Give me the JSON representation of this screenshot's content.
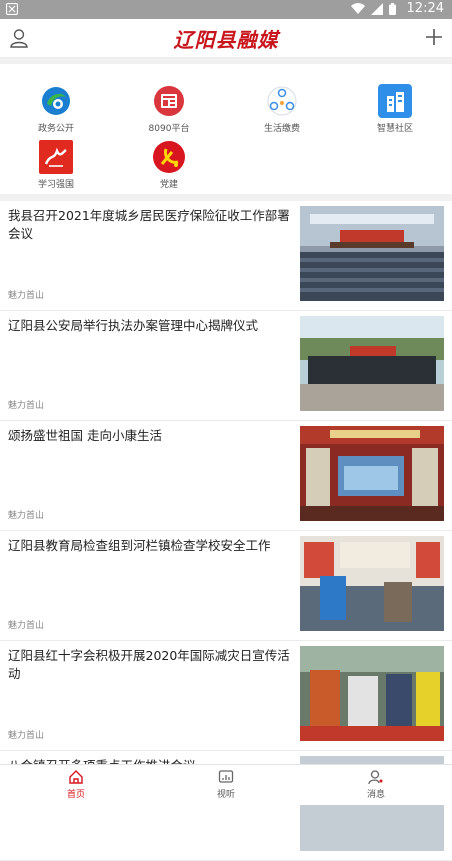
{
  "status_bar": {
    "time": "12:24",
    "icons": [
      "app-indicator-icon",
      "wifi-icon",
      "signal-icon",
      "battery-icon"
    ]
  },
  "header": {
    "logo_text": "辽阳县融媒",
    "icons": [
      "user-icon",
      "plus-icon"
    ]
  },
  "services": [
    {
      "label": "政务公开",
      "icon": "government-icon"
    },
    {
      "label": "8090平台",
      "icon": "platform-8090-icon"
    },
    {
      "label": "生活缴费",
      "icon": "life-payment-icon"
    },
    {
      "label": "智慧社区",
      "icon": "smart-community-icon"
    },
    {
      "label": "学习强国",
      "icon": "study-strong-country-icon"
    },
    {
      "label": "党建",
      "icon": "party-building-icon"
    }
  ],
  "news": [
    {
      "title": "我县召开2021年度城乡居民医疗保险征收工作部署会议",
      "source": "魅力首山"
    },
    {
      "title": "辽阳县公安局举行执法办案管理中心揭牌仪式",
      "source": "魅力首山"
    },
    {
      "title": "颂扬盛世祖国  走向小康生活",
      "source": "魅力首山"
    },
    {
      "title": "辽阳县教育局检查组到河栏镇检查学校安全工作",
      "source": "魅力首山"
    },
    {
      "title": "辽阳县红十字会积极开展2020年国际减灾日宣传活动",
      "source": "魅力首山"
    },
    {
      "title": "八会镇召开多项重点工作推进会议",
      "source": ""
    }
  ],
  "bottom_nav": [
    {
      "label": "首页",
      "icon": "home-icon",
      "active": true
    },
    {
      "label": "视听",
      "icon": "audio-video-icon",
      "active": false
    },
    {
      "label": "消息",
      "icon": "message-icon",
      "active": false
    }
  ],
  "colors": {
    "brand_red": "#c8161d",
    "status_bar": "#9e9e9e",
    "divider": "#f1f1f1"
  }
}
